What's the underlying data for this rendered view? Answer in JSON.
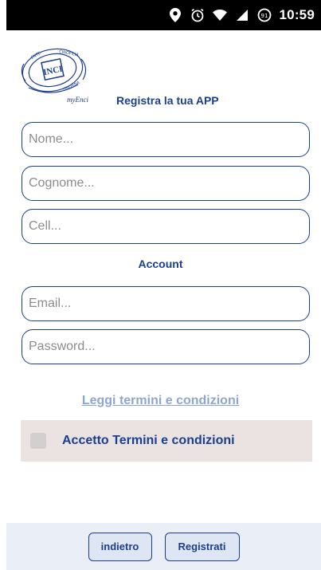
{
  "status_bar": {
    "time": "10:59",
    "icons": [
      "location-pin-icon",
      "alarm-icon",
      "wifi-icon",
      "signal-icon",
      "battery-icon"
    ]
  },
  "header": {
    "logo_name": "myEnci logo",
    "title": "Registra la tua APP"
  },
  "personal": {
    "nome_placeholder": "Nome...",
    "cognome_placeholder": "Cognome...",
    "cell_placeholder": "Cell..."
  },
  "account": {
    "title": "Account",
    "email_placeholder": "Email...",
    "password_placeholder": "Password..."
  },
  "terms": {
    "link_text": "Leggi termini e condizioni",
    "accept_label": "Accetto Termini e condizioni",
    "accepted": false
  },
  "actions": {
    "back_label": "indietro",
    "register_label": "Registrati"
  },
  "colors": {
    "accent": "#1b3f8f",
    "link": "#8ea6cf",
    "accept_bg": "#ebe3e2",
    "bottom_bar_bg": "#e9eef7"
  }
}
